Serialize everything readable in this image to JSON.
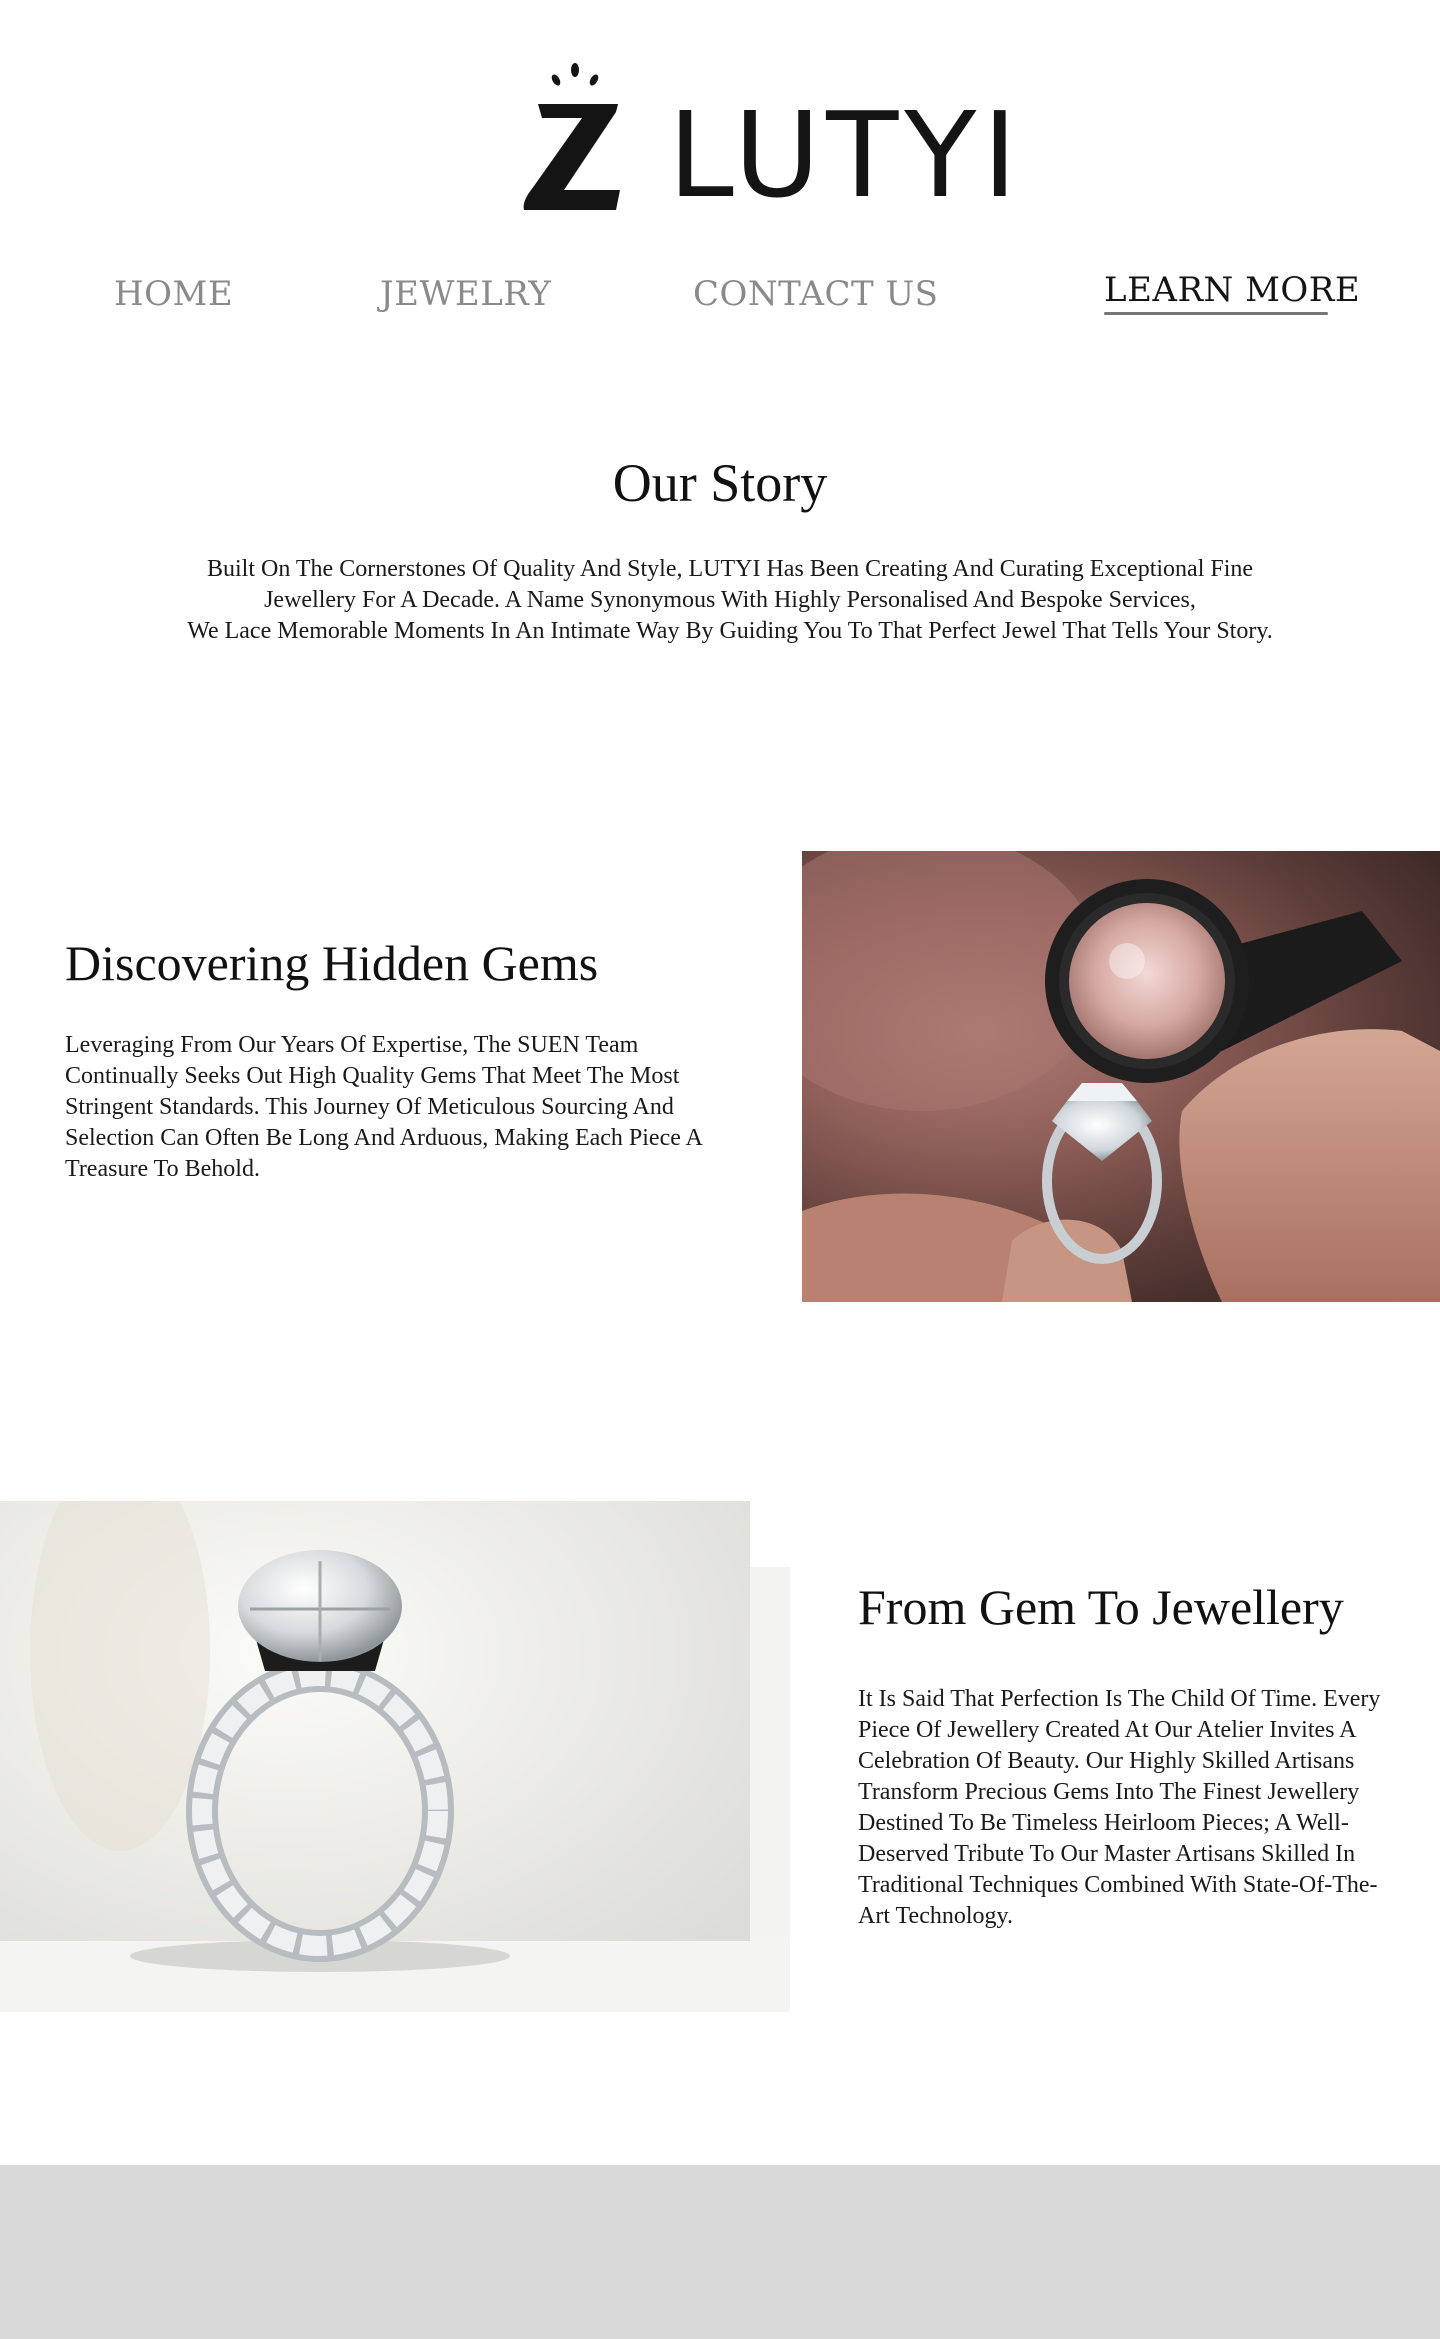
{
  "brand": {
    "name": "LUTYI",
    "logo_icon": "diamond-sparkle-z-icon"
  },
  "nav": {
    "items": [
      {
        "label": "HOME"
      },
      {
        "label": "JEWELRY"
      },
      {
        "label": "CONTACT US"
      },
      {
        "label": "LEARN MORE",
        "active": true
      }
    ]
  },
  "story": {
    "title": "Our Story",
    "lines": [
      "Built On The Cornerstones Of Quality And Style, LUTYI Has Been Creating And Curating Exceptional Fine",
      "Jewellery For A Decade. A Name Synonymous With Highly Personalised And Bespoke Services,",
      "We Lace Memorable Moments In An Intimate Way By Guiding You To That Perfect Jewel That Tells Your Story."
    ]
  },
  "section_gems": {
    "title": "Discovering Hidden Gems",
    "body": "Leveraging From Our Years Of Expertise, The SUEN Team Continually Seeks Out High Quality Gems That Meet The Most Stringent Standards. This Journey Of Meticulous Sourcing And Selection Can Often Be Long And Arduous, Making Each Piece A Treasure To Behold.",
    "image": "jeweler-loupe-inspecting-ring-photo"
  },
  "section_jewellery": {
    "title": "From Gem To Jewellery",
    "body": "It Is Said That Perfection Is The Child Of Time. Every Piece Of Jewellery Created At Our Atelier Invites A Celebration Of Beauty. Our Highly Skilled Artisans Transform Precious Gems Into The Finest Jewellery Destined To Be Timeless Heirloom Pieces; A Well-Deserved Tribute To Our Master Artisans Skilled In Traditional Techniques Combined With State-Of-The-Art Technology.",
    "image": "diamond-eternity-ring-photo"
  },
  "colors": {
    "nav_inactive": "#8a8a8a",
    "nav_active": "#141414",
    "footer_bg": "#d9d9d9"
  }
}
